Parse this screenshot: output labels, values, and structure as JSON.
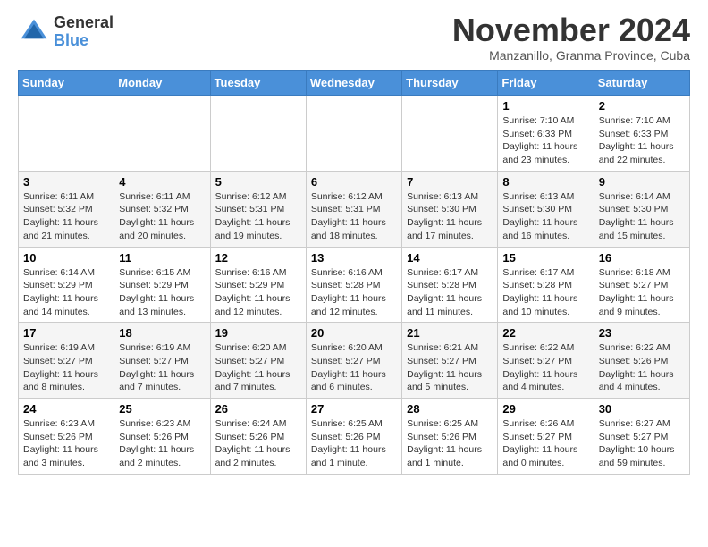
{
  "logo": {
    "general": "General",
    "blue": "Blue"
  },
  "title": "November 2024",
  "subtitle": "Manzanillo, Granma Province, Cuba",
  "days_of_week": [
    "Sunday",
    "Monday",
    "Tuesday",
    "Wednesday",
    "Thursday",
    "Friday",
    "Saturday"
  ],
  "weeks": [
    [
      {
        "day": "",
        "info": ""
      },
      {
        "day": "",
        "info": ""
      },
      {
        "day": "",
        "info": ""
      },
      {
        "day": "",
        "info": ""
      },
      {
        "day": "",
        "info": ""
      },
      {
        "day": "1",
        "info": "Sunrise: 7:10 AM\nSunset: 6:33 PM\nDaylight: 11 hours\nand 23 minutes."
      },
      {
        "day": "2",
        "info": "Sunrise: 7:10 AM\nSunset: 6:33 PM\nDaylight: 11 hours\nand 22 minutes."
      }
    ],
    [
      {
        "day": "3",
        "info": "Sunrise: 6:11 AM\nSunset: 5:32 PM\nDaylight: 11 hours\nand 21 minutes."
      },
      {
        "day": "4",
        "info": "Sunrise: 6:11 AM\nSunset: 5:32 PM\nDaylight: 11 hours\nand 20 minutes."
      },
      {
        "day": "5",
        "info": "Sunrise: 6:12 AM\nSunset: 5:31 PM\nDaylight: 11 hours\nand 19 minutes."
      },
      {
        "day": "6",
        "info": "Sunrise: 6:12 AM\nSunset: 5:31 PM\nDaylight: 11 hours\nand 18 minutes."
      },
      {
        "day": "7",
        "info": "Sunrise: 6:13 AM\nSunset: 5:30 PM\nDaylight: 11 hours\nand 17 minutes."
      },
      {
        "day": "8",
        "info": "Sunrise: 6:13 AM\nSunset: 5:30 PM\nDaylight: 11 hours\nand 16 minutes."
      },
      {
        "day": "9",
        "info": "Sunrise: 6:14 AM\nSunset: 5:30 PM\nDaylight: 11 hours\nand 15 minutes."
      }
    ],
    [
      {
        "day": "10",
        "info": "Sunrise: 6:14 AM\nSunset: 5:29 PM\nDaylight: 11 hours\nand 14 minutes."
      },
      {
        "day": "11",
        "info": "Sunrise: 6:15 AM\nSunset: 5:29 PM\nDaylight: 11 hours\nand 13 minutes."
      },
      {
        "day": "12",
        "info": "Sunrise: 6:16 AM\nSunset: 5:29 PM\nDaylight: 11 hours\nand 12 minutes."
      },
      {
        "day": "13",
        "info": "Sunrise: 6:16 AM\nSunset: 5:28 PM\nDaylight: 11 hours\nand 12 minutes."
      },
      {
        "day": "14",
        "info": "Sunrise: 6:17 AM\nSunset: 5:28 PM\nDaylight: 11 hours\nand 11 minutes."
      },
      {
        "day": "15",
        "info": "Sunrise: 6:17 AM\nSunset: 5:28 PM\nDaylight: 11 hours\nand 10 minutes."
      },
      {
        "day": "16",
        "info": "Sunrise: 6:18 AM\nSunset: 5:27 PM\nDaylight: 11 hours\nand 9 minutes."
      }
    ],
    [
      {
        "day": "17",
        "info": "Sunrise: 6:19 AM\nSunset: 5:27 PM\nDaylight: 11 hours\nand 8 minutes."
      },
      {
        "day": "18",
        "info": "Sunrise: 6:19 AM\nSunset: 5:27 PM\nDaylight: 11 hours\nand 7 minutes."
      },
      {
        "day": "19",
        "info": "Sunrise: 6:20 AM\nSunset: 5:27 PM\nDaylight: 11 hours\nand 7 minutes."
      },
      {
        "day": "20",
        "info": "Sunrise: 6:20 AM\nSunset: 5:27 PM\nDaylight: 11 hours\nand 6 minutes."
      },
      {
        "day": "21",
        "info": "Sunrise: 6:21 AM\nSunset: 5:27 PM\nDaylight: 11 hours\nand 5 minutes."
      },
      {
        "day": "22",
        "info": "Sunrise: 6:22 AM\nSunset: 5:27 PM\nDaylight: 11 hours\nand 4 minutes."
      },
      {
        "day": "23",
        "info": "Sunrise: 6:22 AM\nSunset: 5:26 PM\nDaylight: 11 hours\nand 4 minutes."
      }
    ],
    [
      {
        "day": "24",
        "info": "Sunrise: 6:23 AM\nSunset: 5:26 PM\nDaylight: 11 hours\nand 3 minutes."
      },
      {
        "day": "25",
        "info": "Sunrise: 6:23 AM\nSunset: 5:26 PM\nDaylight: 11 hours\nand 2 minutes."
      },
      {
        "day": "26",
        "info": "Sunrise: 6:24 AM\nSunset: 5:26 PM\nDaylight: 11 hours\nand 2 minutes."
      },
      {
        "day": "27",
        "info": "Sunrise: 6:25 AM\nSunset: 5:26 PM\nDaylight: 11 hours\nand 1 minute."
      },
      {
        "day": "28",
        "info": "Sunrise: 6:25 AM\nSunset: 5:26 PM\nDaylight: 11 hours\nand 1 minute."
      },
      {
        "day": "29",
        "info": "Sunrise: 6:26 AM\nSunset: 5:27 PM\nDaylight: 11 hours\nand 0 minutes."
      },
      {
        "day": "30",
        "info": "Sunrise: 6:27 AM\nSunset: 5:27 PM\nDaylight: 10 hours\nand 59 minutes."
      }
    ]
  ]
}
